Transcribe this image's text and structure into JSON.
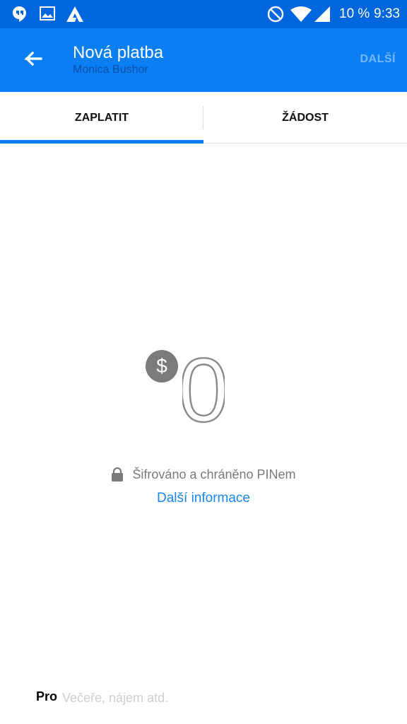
{
  "status_bar": {
    "battery": "10 %",
    "time": "9:33",
    "icons": [
      "hangouts-icon",
      "gallery-icon",
      "app-a-icon",
      "dnd-icon",
      "wifi-icon",
      "signal-icon",
      "battery-icon"
    ]
  },
  "app_bar": {
    "title": "Nová platba",
    "subtitle": "Monica Bushor",
    "next_label": "DALŠÍ"
  },
  "tabs": [
    {
      "label": "ZAPLATIT",
      "selected": true
    },
    {
      "label": "ŽÁDOST",
      "selected": false
    }
  ],
  "amount": {
    "currency_symbol": "$",
    "value": "0"
  },
  "security": {
    "text": "Šifrováno a chráněno PINem",
    "link": "Další informace"
  },
  "memo": {
    "label": "Pro",
    "placeholder": "Večeře, nájem atd."
  },
  "colors": {
    "status_bar": "#0066de",
    "app_bar": "#0a7ff3",
    "accent": "#0a7ff3",
    "link": "#1a86f0"
  }
}
